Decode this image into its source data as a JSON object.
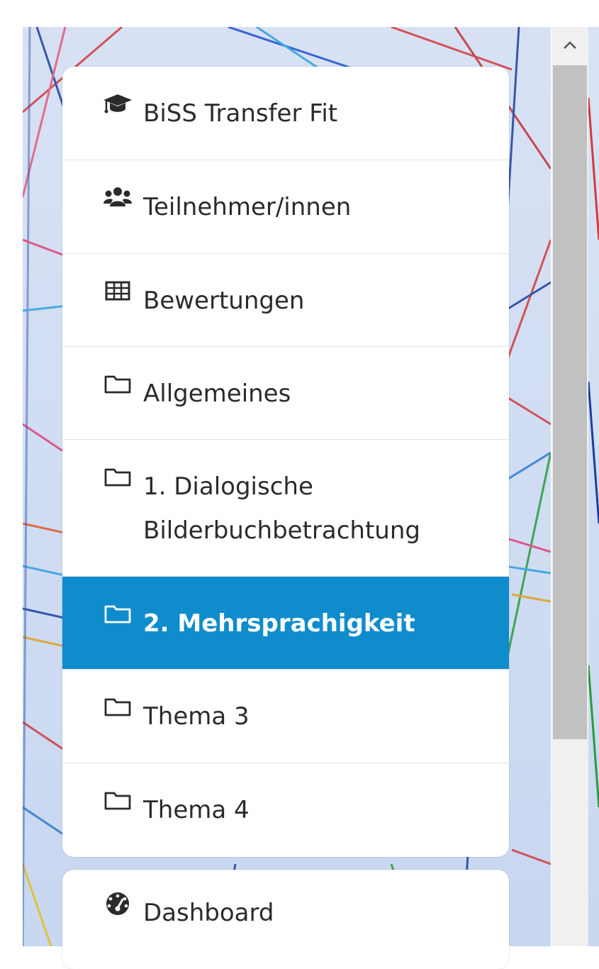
{
  "navigation": {
    "items": [
      {
        "label": "BiSS Transfer Fit",
        "icon": "graduation-cap-icon"
      },
      {
        "label": "Teilnehmer/innen",
        "icon": "users-icon"
      },
      {
        "label": "Bewertungen",
        "icon": "table-icon"
      },
      {
        "label": "Allgemeines",
        "icon": "folder-icon"
      },
      {
        "label_line1": "1. Dialogische",
        "label_line2": "Bilderbuchbetrachtung",
        "icon": "folder-icon"
      },
      {
        "label": "2. Mehrsprachigkeit",
        "icon": "folder-icon",
        "active": true
      },
      {
        "label": "Thema 3",
        "icon": "folder-icon"
      },
      {
        "label": "Thema 4",
        "icon": "folder-icon"
      }
    ]
  },
  "secondary_navigation": {
    "items": [
      {
        "label": "Dashboard",
        "icon": "dashboard-icon"
      }
    ]
  },
  "colors": {
    "active_background": "#0f8ccc",
    "active_text": "#ffffff",
    "text": "#2b2b2b",
    "scrollbar_track": "#f0f0f0",
    "scrollbar_thumb": "#c1c1c1"
  }
}
